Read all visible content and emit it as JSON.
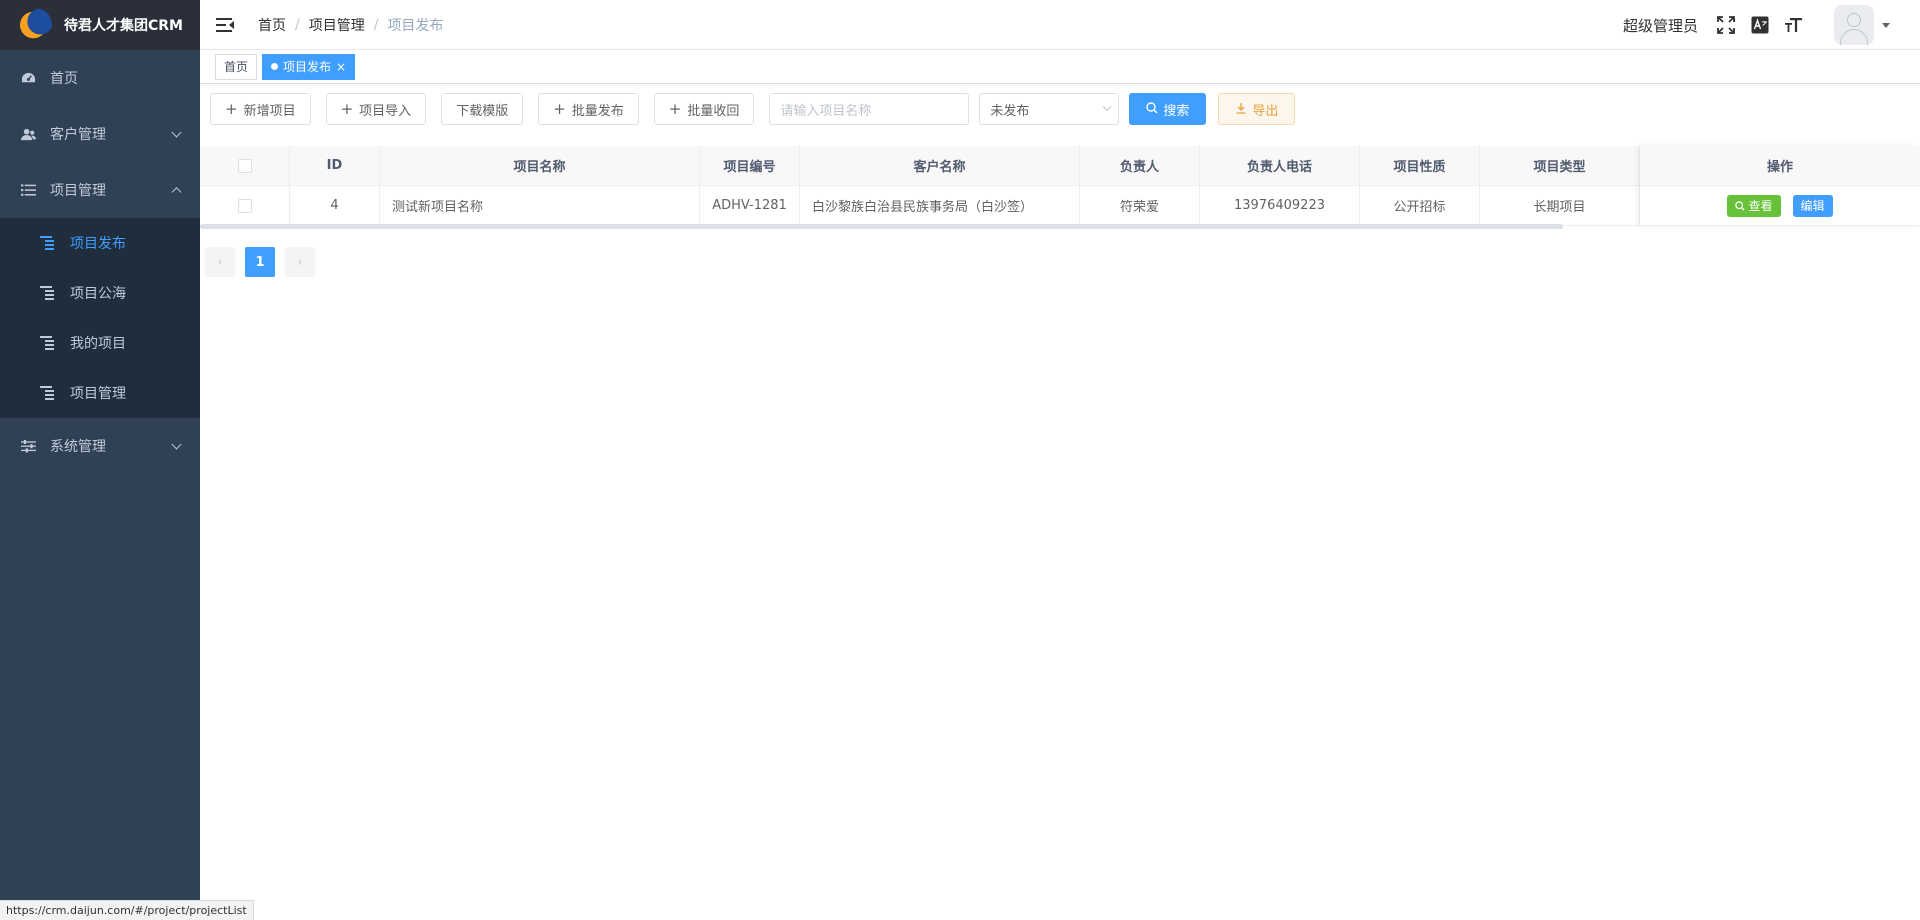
{
  "app": {
    "title": "待君人才集团CRM"
  },
  "sidebar": {
    "items": [
      {
        "label": "首页",
        "icon": "dashboard-icon"
      },
      {
        "label": "客户管理",
        "icon": "users-icon"
      },
      {
        "label": "项目管理",
        "icon": "list-icon",
        "expanded": true,
        "children": [
          {
            "label": "项目发布",
            "active": true
          },
          {
            "label": "项目公海"
          },
          {
            "label": "我的项目"
          },
          {
            "label": "项目管理"
          }
        ]
      },
      {
        "label": "系统管理",
        "icon": "settings-icon"
      }
    ]
  },
  "breadcrumb": [
    "首页",
    "项目管理",
    "项目发布"
  ],
  "header": {
    "user": "超级管理员"
  },
  "tags": [
    {
      "label": "首页",
      "active": false
    },
    {
      "label": "项目发布",
      "active": true
    }
  ],
  "toolbar": {
    "add": "新增项目",
    "import": "项目导入",
    "download": "下载模版",
    "batch_publish": "批量发布",
    "batch_recall": "批量收回",
    "search_placeholder": "请输入项目名称",
    "status_select": "未发布",
    "search": "搜索",
    "export": "导出"
  },
  "table": {
    "columns": [
      "ID",
      "项目名称",
      "项目编号",
      "客户名称",
      "负责人",
      "负责人电话",
      "项目性质",
      "项目类型",
      "操作"
    ],
    "rows": [
      {
        "id": "4",
        "name": "测试新项目名称",
        "code": "ADHV-1281",
        "customer": "白沙黎族白治县民族事务局（白沙签）",
        "owner": "符荣爱",
        "phone": "13976409223",
        "nature": "公开招标",
        "type": "长期项目",
        "view": "查看",
        "edit": "编辑"
      }
    ]
  },
  "pagination": {
    "current": "1"
  },
  "status_url": "https://crm.daijun.com/#/project/projectList",
  "colors": {
    "sidebar_bg": "#304156",
    "submenu_bg": "#1f2d3d",
    "accent": "#409eff",
    "success": "#67c23a",
    "warning": "#e6a23c"
  }
}
